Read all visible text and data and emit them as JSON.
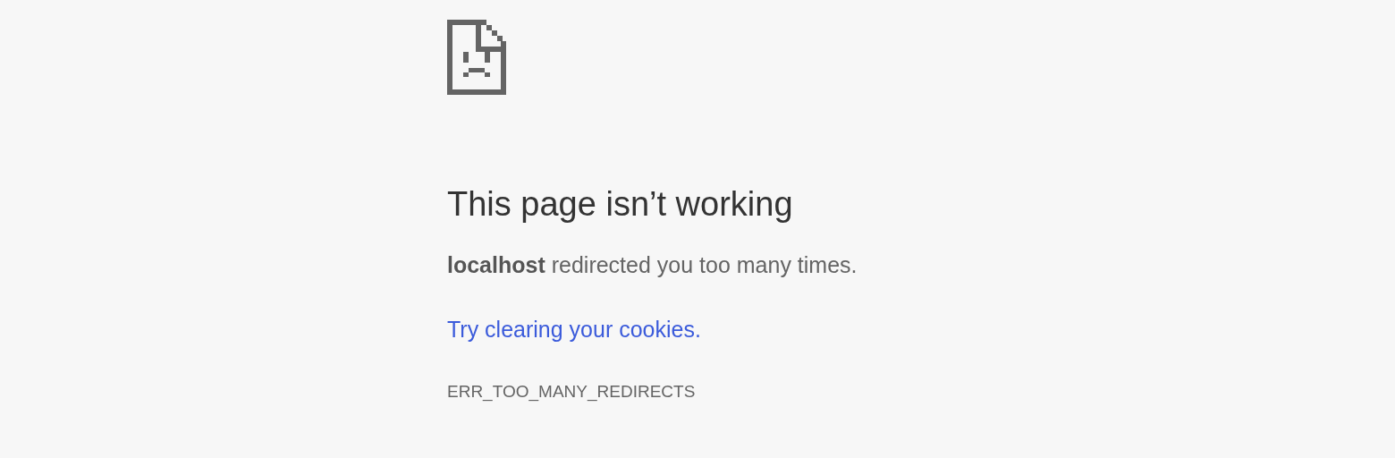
{
  "heading": "This page isn’t working",
  "message": "**localhost** redirected you too many times.",
  "link": "Try clearing your cookies.",
  "error_code": "ERR_TOO_MANY_REDIRECTS"
}
